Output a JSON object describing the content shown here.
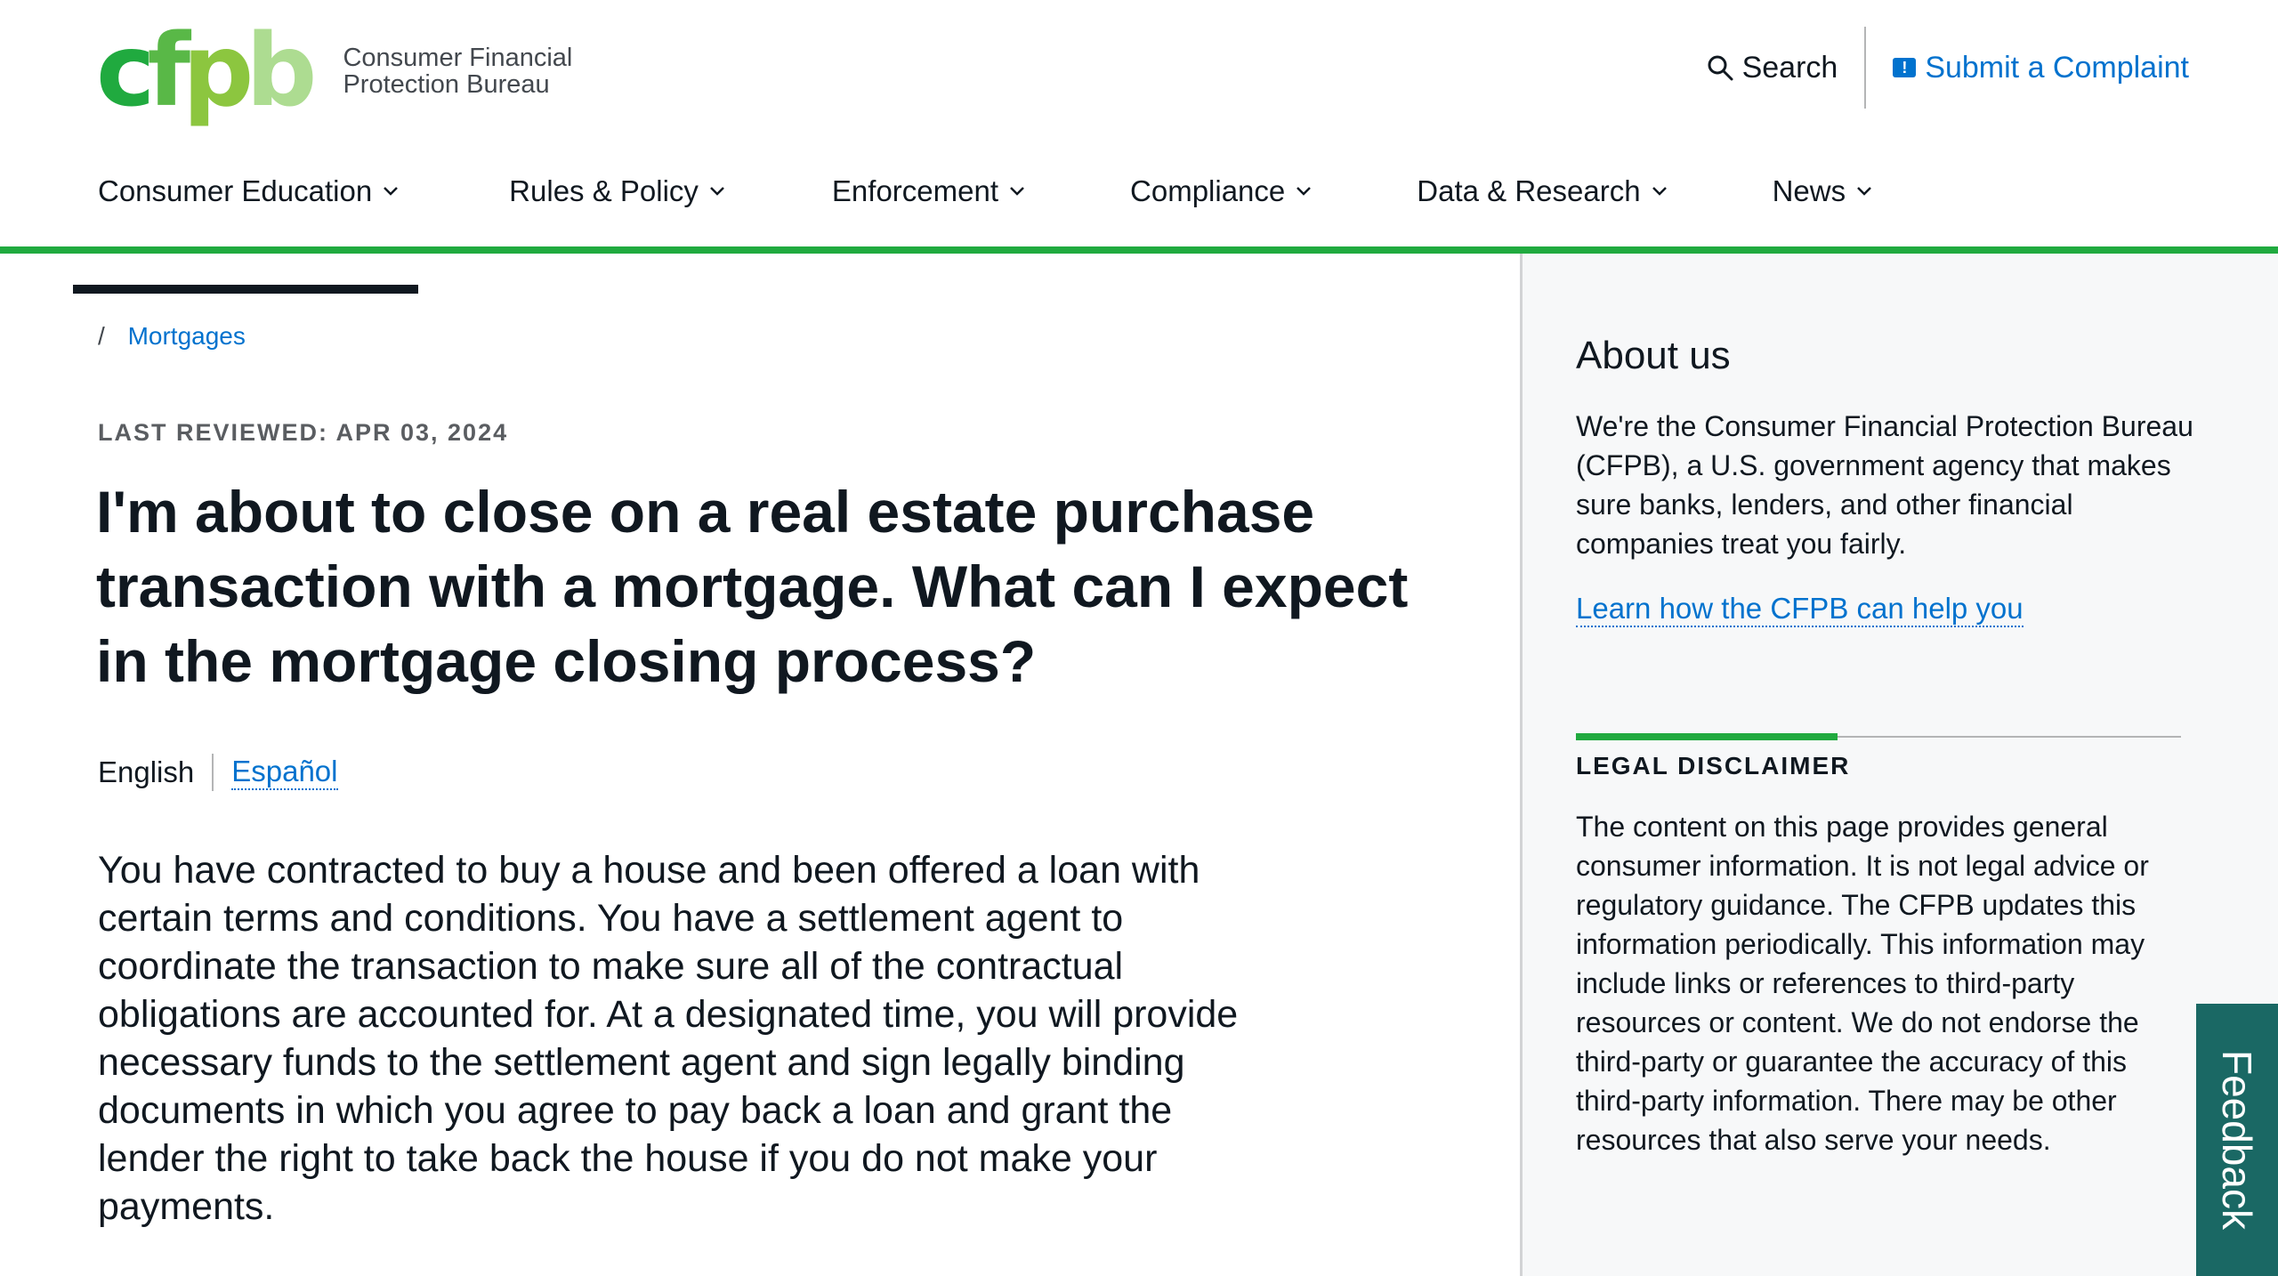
{
  "header": {
    "logo_mark": "cfpb",
    "logo_line1": "Consumer Financial",
    "logo_line2": "Protection Bureau",
    "search_label": "Search",
    "complaint_label": "Submit a Complaint"
  },
  "nav": {
    "items": [
      {
        "label": "Consumer Education",
        "active": true
      },
      {
        "label": "Rules & Policy"
      },
      {
        "label": "Enforcement"
      },
      {
        "label": "Compliance"
      },
      {
        "label": "Data & Research"
      },
      {
        "label": "News"
      }
    ]
  },
  "main": {
    "breadcrumb_sep": "/",
    "breadcrumb_link": "Mortgages",
    "last_reviewed": "LAST REVIEWED: APR 03, 2024",
    "title": "I'm about to close on a real estate purchase transaction with a mortgage. What can I expect in the mortgage closing process?",
    "lang_current": "English",
    "lang_alt": "Español",
    "body": "You have contracted to buy a house and been offered a loan with certain terms and conditions. You have a settlement agent to coordinate the transaction to make sure all of the contractual obligations are accounted for. At a designated time, you will provide necessary funds to the settlement agent and sign legally binding documents in which you agree to pay back a loan and grant the lender the right to take back the house if you do not make your payments."
  },
  "sidebar": {
    "about_title": "About us",
    "about_text": "We're the Consumer Financial Protection Bureau (CFPB), a U.S. government agency that makes sure banks, lenders, and other financial companies treat you fairly.",
    "about_link": "Learn how the CFPB can help you",
    "disclaimer_heading": "LEGAL DISCLAIMER",
    "disclaimer_text": "The content on this page provides general consumer information. It is not legal advice or regulatory guidance. The CFPB updates this information periodically. This information may include links or references to third-party resources or content. We do not endorse the third-party or guarantee the accuracy of this third-party information. There may be other resources that also serve your needs."
  },
  "feedback_label": "Feedback",
  "colors": {
    "brand_green": "#20aa3f",
    "link_blue": "#0072ce",
    "feedback_teal": "#1a6864"
  }
}
